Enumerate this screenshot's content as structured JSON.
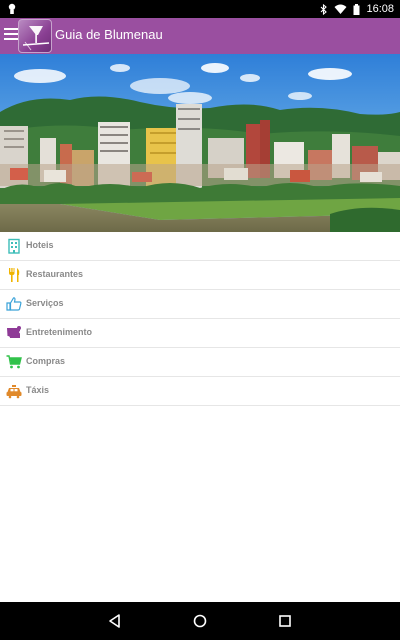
{
  "status_bar": {
    "time": "16:08"
  },
  "app_bar": {
    "title": "Guia de Blumenau",
    "color": "#9a4fa0"
  },
  "categories": [
    {
      "label": "Hoteis",
      "icon": "hotel-icon",
      "color": "#3dbdb8"
    },
    {
      "label": "Restaurantes",
      "icon": "fork-knife-icon",
      "color": "#f0b400"
    },
    {
      "label": "Serviços",
      "icon": "thumbs-up-icon",
      "color": "#3aa2d8"
    },
    {
      "label": "Entretenimento",
      "icon": "ticket-icon",
      "color": "#8e3a96"
    },
    {
      "label": "Compras",
      "icon": "shopping-cart-icon",
      "color": "#31c24a"
    },
    {
      "label": "Táxis",
      "icon": "taxi-icon",
      "color": "#e0892a"
    }
  ]
}
